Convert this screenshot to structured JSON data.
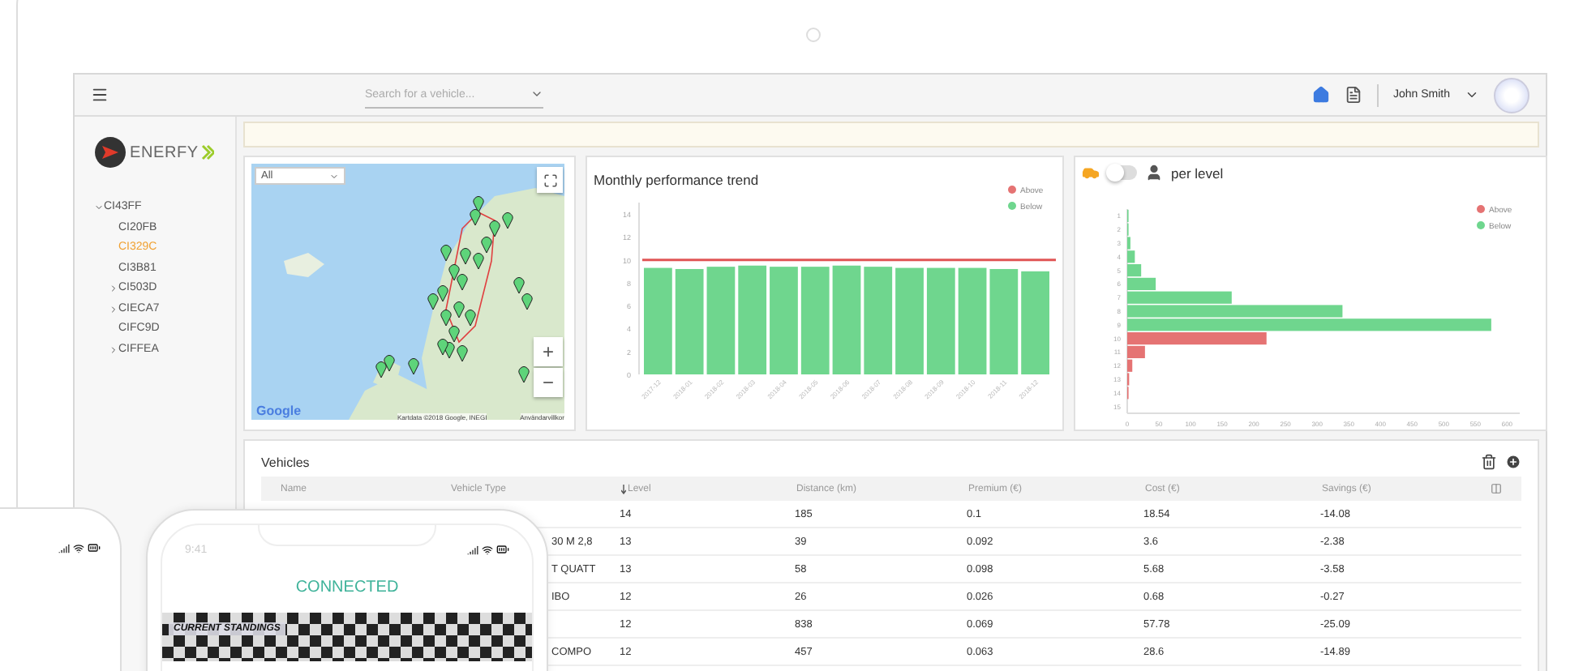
{
  "topbar": {
    "search": {
      "placeholder": "Search for a vehicle..."
    },
    "user": {
      "name": "John Smith"
    }
  },
  "sidebar": {
    "logo": "ENERFY",
    "tree": [
      {
        "label": "CI43FF",
        "kind": "branch",
        "expanded": true,
        "selected": false,
        "children": [
          {
            "label": "CI20FB",
            "kind": "leaf",
            "expanded": false,
            "selected": false
          },
          {
            "label": "CI329C",
            "kind": "leaf",
            "expanded": false,
            "selected": true
          },
          {
            "label": "CI3B81",
            "kind": "leaf",
            "expanded": false,
            "selected": false
          },
          {
            "label": "CI503D",
            "kind": "branch",
            "expanded": false,
            "selected": false
          },
          {
            "label": "CIECA7",
            "kind": "branch",
            "expanded": false,
            "selected": false
          },
          {
            "label": "CIFC9D",
            "kind": "leaf",
            "expanded": false,
            "selected": false
          },
          {
            "label": "CIFFEA",
            "kind": "branch",
            "expanded": false,
            "selected": false
          }
        ]
      }
    ]
  },
  "map_card": {
    "filter": "All",
    "zoom_in": "+",
    "zoom_out": "−",
    "logo": "Google",
    "attribution": "Kartdata ©2018 Google, INEGI",
    "terms": "Användarvillkor"
  },
  "trend_card": {
    "title": "Monthly performance trend",
    "chart_data": {
      "type": "bar",
      "categories": [
        "2017-12",
        "2018-01",
        "2018-02",
        "2018-03",
        "2018-04",
        "2018-05",
        "2018-06",
        "2018-07",
        "2018-08",
        "2018-09",
        "2018-10",
        "2018-11",
        "2018-12"
      ],
      "series": [
        {
          "name": "Above",
          "color": "#e57373",
          "values": [
            null,
            null,
            null,
            null,
            null,
            null,
            null,
            null,
            null,
            null,
            null,
            null,
            null
          ]
        },
        {
          "name": "Below",
          "color": "#6fd68e",
          "values": [
            9.3,
            9.2,
            9.4,
            9.5,
            9.4,
            9.4,
            9.5,
            9.4,
            9.3,
            9.3,
            9.3,
            9.2,
            9.0
          ]
        }
      ],
      "ylim": [
        0,
        15
      ],
      "yticks": [
        0,
        2,
        4,
        6,
        8,
        10,
        12,
        14
      ],
      "ref_lines": [
        {
          "axis": "y",
          "value": 10,
          "color": "#e05555"
        }
      ],
      "legend": "upper right"
    }
  },
  "level_card": {
    "title": "per level",
    "toggle": {
      "on": false
    },
    "chart_data": {
      "type": "bar",
      "orientation": "horizontal",
      "categories": [
        "1",
        "2",
        "3",
        "4",
        "5",
        "6",
        "7",
        "8",
        "9",
        "10",
        "11",
        "12",
        "13",
        "14",
        "15"
      ],
      "series": [
        {
          "name": "Above",
          "color": "#e57373",
          "values": [
            null,
            null,
            null,
            null,
            null,
            null,
            null,
            null,
            null,
            220,
            28,
            8,
            3,
            2,
            0
          ]
        },
        {
          "name": "Below",
          "color": "#6fd68e",
          "values": [
            2,
            2,
            5,
            12,
            22,
            45,
            165,
            340,
            575,
            null,
            null,
            null,
            null,
            null,
            null
          ]
        }
      ],
      "xlim": [
        0,
        620
      ],
      "xticks": [
        0,
        50,
        100,
        150,
        200,
        250,
        300,
        350,
        400,
        450,
        500,
        550,
        600
      ],
      "legend": "upper right"
    }
  },
  "vehicles": {
    "title": "Vehicles",
    "columns": [
      {
        "label": "Name",
        "sorted": false
      },
      {
        "label": "Vehicle Type",
        "sorted": false
      },
      {
        "label": "Level",
        "sorted": true
      },
      {
        "label": "Distance (km)",
        "sorted": false
      },
      {
        "label": "Premium (€)",
        "sorted": false
      },
      {
        "label": "Cost (€)",
        "sorted": false
      },
      {
        "label": "Savings (€)",
        "sorted": false
      }
    ],
    "rows": [
      {
        "level": "14",
        "distance": "185",
        "premium": "0.1",
        "cost": "18.54",
        "savings": "-14.08"
      },
      {
        "type": "30 M 2,8",
        "level": "13",
        "distance": "39",
        "premium": "0.092",
        "cost": "3.6",
        "savings": "-2.38"
      },
      {
        "type": "T QUATT",
        "level": "13",
        "distance": "58",
        "premium": "0.098",
        "cost": "5.68",
        "savings": "-3.58"
      },
      {
        "type": "IBO",
        "level": "12",
        "distance": "26",
        "premium": "0.026",
        "cost": "0.68",
        "savings": "-0.27"
      },
      {
        "level": "12",
        "distance": "838",
        "premium": "0.069",
        "cost": "57.78",
        "savings": "-25.09"
      },
      {
        "type": "COMPO",
        "level": "12",
        "distance": "457",
        "premium": "0.063",
        "cost": "28.6",
        "savings": "-14.89"
      }
    ]
  },
  "phone": {
    "time": "9:41",
    "status": "CONNECTED",
    "banner": "CURRENT STANDINGS"
  }
}
